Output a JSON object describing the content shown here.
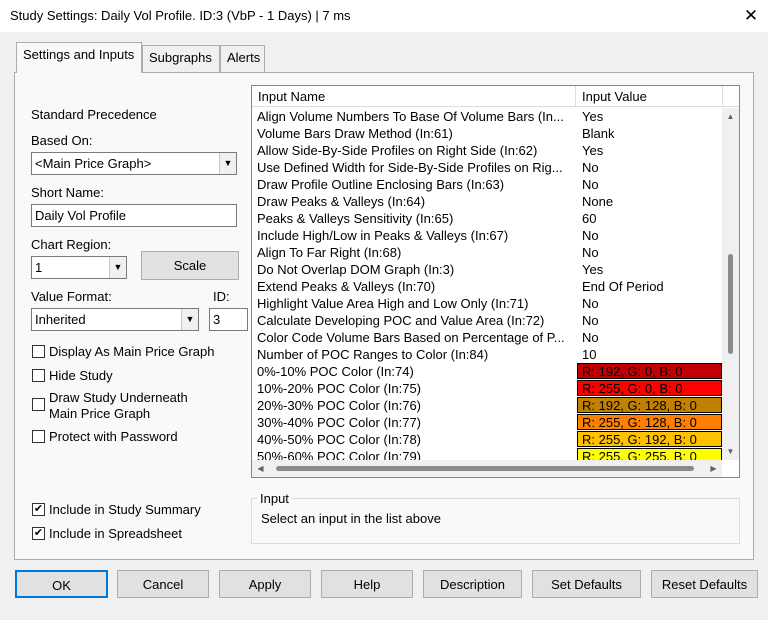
{
  "window": {
    "title": "Study Settings: Daily Vol Profile. ID:3 (VbP - 1 Days) | 7 ms",
    "close_glyph": "✕"
  },
  "tabs": [
    {
      "label": "Settings and Inputs",
      "active": true
    },
    {
      "label": "Subgraphs",
      "active": false
    },
    {
      "label": "Alerts",
      "active": false
    }
  ],
  "left": {
    "standard_precedence": "Standard Precedence",
    "based_on_label": "Based On:",
    "based_on_value": "<Main Price Graph>",
    "short_name_label": "Short Name:",
    "short_name_value": "Daily Vol Profile",
    "chart_region_label": "Chart Region:",
    "chart_region_value": "1",
    "scale_button": "Scale",
    "value_format_label": "Value Format:",
    "value_format_value": "Inherited",
    "id_label": "ID:",
    "id_value": "3",
    "checkboxes": {
      "display_main": {
        "label": "Display As Main Price Graph",
        "checked": false
      },
      "hide_study": {
        "label": "Hide Study",
        "checked": false
      },
      "draw_underneath_1": "Draw Study Underneath",
      "draw_underneath_2": "Main Price Graph",
      "draw_underneath_checked": false,
      "protect": {
        "label": "Protect with Password",
        "checked": false
      },
      "include_summary": {
        "label": "Include in Study Summary",
        "checked": true
      },
      "include_spreadsheet": {
        "label": "Include in Spreadsheet",
        "checked": true
      }
    },
    "check_glyph": "✔"
  },
  "inputs_list": {
    "header_name": "Input Name",
    "header_value": "Input Value",
    "rows": [
      {
        "name": "Align Volume Numbers To Base Of Volume Bars  (In...",
        "value": "Yes"
      },
      {
        "name": "Volume Bars Draw Method  (In:61)",
        "value": "Blank"
      },
      {
        "name": "Allow Side-By-Side Profiles on Right Side  (In:62)",
        "value": "Yes"
      },
      {
        "name": "Use Defined Width for Side-By-Side Profiles on Rig...",
        "value": "No"
      },
      {
        "name": "Draw Profile Outline Enclosing Bars  (In:63)",
        "value": "No"
      },
      {
        "name": "Draw Peaks & Valleys  (In:64)",
        "value": "None"
      },
      {
        "name": "Peaks & Valleys Sensitivity  (In:65)",
        "value": "60"
      },
      {
        "name": "Include High/Low in Peaks & Valleys  (In:67)",
        "value": "No"
      },
      {
        "name": "Align To Far Right  (In:68)",
        "value": "No"
      },
      {
        "name": "Do Not Overlap DOM Graph  (In:3)",
        "value": "Yes"
      },
      {
        "name": "Extend Peaks & Valleys  (In:70)",
        "value": "End Of Period"
      },
      {
        "name": "Highlight Value Area High and Low Only  (In:71)",
        "value": "No"
      },
      {
        "name": "Calculate Developing POC and Value Area  (In:72)",
        "value": "No"
      },
      {
        "name": "Color Code Volume Bars Based on Percentage of P...",
        "value": "No"
      },
      {
        "name": "Number of POC Ranges to Color  (In:84)",
        "value": "10"
      },
      {
        "name": "0%-10% POC Color  (In:74)",
        "value": "R: 192, G: 0, B: 0",
        "color": "#c00000"
      },
      {
        "name": "10%-20% POC Color  (In:75)",
        "value": "R: 255, G: 0, B: 0",
        "color": "#ff0000"
      },
      {
        "name": "20%-30% POC Color  (In:76)",
        "value": "R: 192, G: 128, B: 0",
        "color": "#c08000"
      },
      {
        "name": "30%-40% POC Color  (In:77)",
        "value": "R: 255, G: 128, B: 0",
        "color": "#ff8000"
      },
      {
        "name": "40%-50% POC Color  (In:78)",
        "value": "R: 255, G: 192, B: 0",
        "color": "#ffc000"
      },
      {
        "name": "50%-60% POC Color  (In:79)",
        "value": "R: 255, G: 255, B: 0",
        "color": "#ffff00"
      }
    ]
  },
  "input_group": {
    "title": "Input",
    "hint": "Select an input in the list above"
  },
  "buttons": {
    "ok": "OK",
    "cancel": "Cancel",
    "apply": "Apply",
    "help": "Help",
    "description": "Description",
    "set_defaults": "Set Defaults",
    "reset_defaults": "Reset Defaults"
  },
  "colors": {
    "accent_focus": "#0078d7"
  }
}
